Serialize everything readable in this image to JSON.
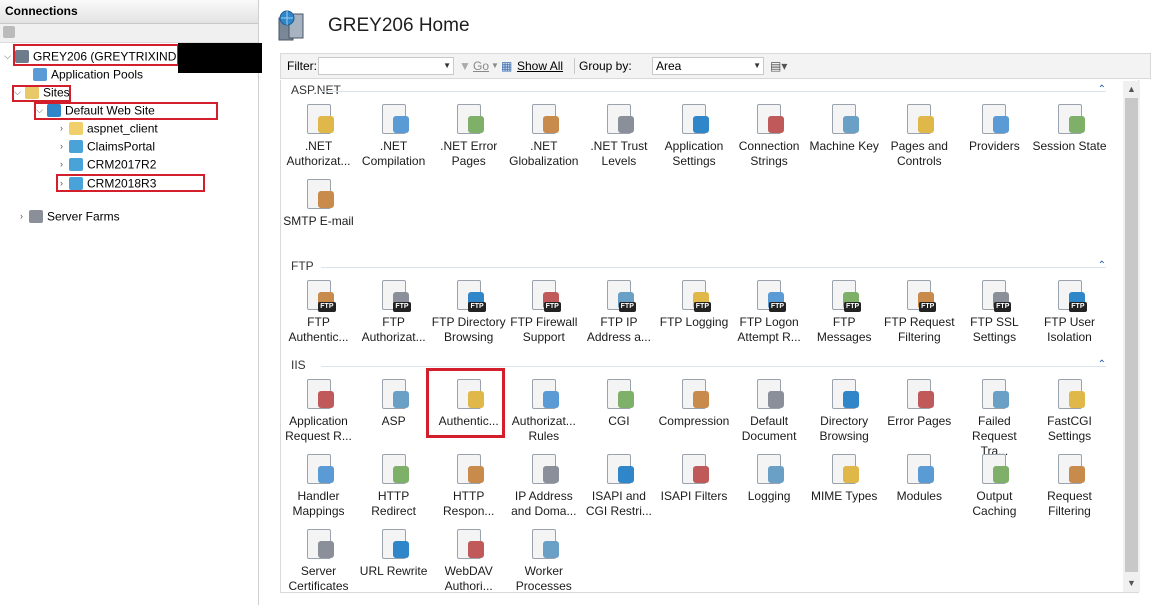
{
  "connections": {
    "header": "Connections",
    "tree": [
      {
        "id": "server",
        "label": "GREY206 (GREYTRIXINDIA\\",
        "expander": "⌵",
        "icon": "server-icon"
      },
      {
        "id": "app-pools",
        "label": "Application Pools",
        "expander": "",
        "icon": "app-pool-icon"
      },
      {
        "id": "sites",
        "label": "Sites",
        "expander": "⌵",
        "icon": "sites-folder-icon"
      },
      {
        "id": "default-web-site",
        "label": "Default Web Site",
        "expander": "⌵",
        "icon": "globe-icon"
      },
      {
        "id": "aspnet-client",
        "label": "aspnet_client",
        "expander": "›",
        "icon": "folder-icon"
      },
      {
        "id": "claims-portal",
        "label": "ClaimsPortal",
        "expander": "›",
        "icon": "web-app-icon"
      },
      {
        "id": "crm2017r2",
        "label": "CRM2017R2",
        "expander": "›",
        "icon": "web-app-icon"
      },
      {
        "id": "crm2018r3",
        "label": "CRM2018R3",
        "expander": "›",
        "icon": "web-app-icon"
      },
      {
        "id": "server-farms",
        "label": "Server Farms",
        "expander": "›",
        "icon": "server-farms-icon"
      }
    ]
  },
  "main": {
    "title": "GREY206 Home",
    "filter_label": "Filter:",
    "go_label": "Go",
    "show_all_label": "Show All",
    "group_by_label": "Group by:",
    "group_by_value": "Area",
    "groups": [
      {
        "name": "ASP.NET",
        "features": [
          {
            "label": "NET Authorizat...",
            "display": ".NET\nAuthorizat...",
            "icon": "net-authorization-icon"
          },
          {
            "label": "NET Compilation",
            "display": ".NET\nCompilation",
            "icon": "net-compilation-icon"
          },
          {
            "label": "NET Error Pages",
            "display": ".NET Error\nPages",
            "icon": "net-error-pages-icon"
          },
          {
            "label": "NET Globalization",
            "display": ".NET\nGlobalization",
            "icon": "net-globalization-icon"
          },
          {
            "label": "NET Trust Levels",
            "display": ".NET Trust\nLevels",
            "icon": "net-trust-levels-icon"
          },
          {
            "label": "Application Settings",
            "display": "Application\nSettings",
            "icon": "application-settings-icon"
          },
          {
            "label": "Connection Strings",
            "display": "Connection\nStrings",
            "icon": "connection-strings-icon"
          },
          {
            "label": "Machine Key",
            "display": "Machine Key",
            "icon": "machine-key-icon"
          },
          {
            "label": "Pages and Controls",
            "display": "Pages and\nControls",
            "icon": "pages-controls-icon"
          },
          {
            "label": "Providers",
            "display": "Providers",
            "icon": "providers-icon"
          },
          {
            "label": "Session State",
            "display": "Session State",
            "icon": "session-state-icon"
          },
          {
            "label": "SMTP E-mail",
            "display": "SMTP E-mail",
            "icon": "smtp-email-icon"
          }
        ]
      },
      {
        "name": "FTP",
        "features": [
          {
            "display": "FTP\nAuthentic...",
            "icon": "ftp-authentication-icon"
          },
          {
            "display": "FTP\nAuthorizat...",
            "icon": "ftp-authorization-icon"
          },
          {
            "display": "FTP Directory\nBrowsing",
            "icon": "ftp-directory-browsing-icon"
          },
          {
            "display": "FTP Firewall\nSupport",
            "icon": "ftp-firewall-icon"
          },
          {
            "display": "FTP IP\nAddress a...",
            "icon": "ftp-ip-address-icon"
          },
          {
            "display": "FTP Logging",
            "icon": "ftp-logging-icon"
          },
          {
            "display": "FTP Logon\nAttempt R...",
            "icon": "ftp-logon-attempt-icon"
          },
          {
            "display": "FTP\nMessages",
            "icon": "ftp-messages-icon"
          },
          {
            "display": "FTP Request\nFiltering",
            "icon": "ftp-request-filtering-icon"
          },
          {
            "display": "FTP SSL\nSettings",
            "icon": "ftp-ssl-icon"
          },
          {
            "display": "FTP User\nIsolation",
            "icon": "ftp-user-isolation-icon"
          }
        ]
      },
      {
        "name": "IIS",
        "features": [
          {
            "display": "Application\nRequest R...",
            "icon": "arr-icon"
          },
          {
            "display": "ASP",
            "icon": "asp-icon"
          },
          {
            "display": "Authentic...",
            "icon": "authentication-icon"
          },
          {
            "display": "Authorizat...\nRules",
            "icon": "authorization-rules-icon"
          },
          {
            "display": "CGI",
            "icon": "cgi-icon"
          },
          {
            "display": "Compression",
            "icon": "compression-icon"
          },
          {
            "display": "Default\nDocument",
            "icon": "default-document-icon"
          },
          {
            "display": "Directory\nBrowsing",
            "icon": "directory-browsing-icon"
          },
          {
            "display": "Error Pages",
            "icon": "error-pages-icon"
          },
          {
            "display": "Failed\nRequest Tra...",
            "icon": "failed-request-tracing-icon"
          },
          {
            "display": "FastCGI\nSettings",
            "icon": "fastcgi-icon"
          },
          {
            "display": "Handler\nMappings",
            "icon": "handler-mappings-icon"
          },
          {
            "display": "HTTP\nRedirect",
            "icon": "http-redirect-icon"
          },
          {
            "display": "HTTP\nRespon...",
            "icon": "http-response-headers-icon"
          },
          {
            "display": "IP Address\nand Doma...",
            "icon": "ip-domain-restrictions-icon"
          },
          {
            "display": "ISAPI and\nCGI Restri...",
            "icon": "isapi-cgi-restrictions-icon"
          },
          {
            "display": "ISAPI Filters",
            "icon": "isapi-filters-icon"
          },
          {
            "display": "Logging",
            "icon": "logging-icon"
          },
          {
            "display": "MIME Types",
            "icon": "mime-types-icon"
          },
          {
            "display": "Modules",
            "icon": "modules-icon"
          },
          {
            "display": "Output\nCaching",
            "icon": "output-caching-icon"
          },
          {
            "display": "Request\nFiltering",
            "icon": "request-filtering-icon"
          },
          {
            "display": "Server\nCertificates",
            "icon": "server-certificates-icon"
          },
          {
            "display": "URL Rewrite",
            "icon": "url-rewrite-icon"
          },
          {
            "display": "WebDAV\nAuthori...",
            "icon": "webdav-icon"
          },
          {
            "display": "Worker\nProcesses",
            "icon": "worker-processes-icon"
          }
        ]
      }
    ]
  },
  "colors": {
    "highlight": "#d21f2b",
    "group_header": "#333333",
    "collapse_chevron": "#1f5aa0"
  }
}
